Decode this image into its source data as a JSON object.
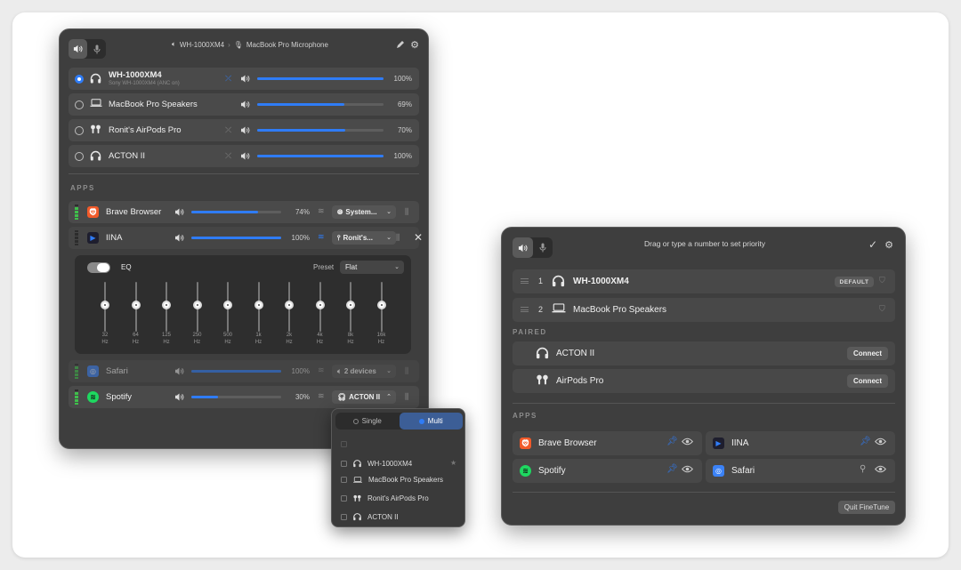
{
  "left": {
    "header_output": "WH-1000XM4",
    "header_sep": "›",
    "header_input": "MacBook Pro Microphone",
    "devices": [
      {
        "name": "WH-1000XM4",
        "sub": "Sony WH-1000XM4 (ANC on)",
        "percent": "100%",
        "level": 1.0,
        "icon": "headphones-icon",
        "selected": true
      },
      {
        "name": "MacBook Pro Speakers",
        "sub": "",
        "percent": "69%",
        "level": 0.69,
        "icon": "laptop-icon",
        "selected": false
      },
      {
        "name": "Ronit's AirPods Pro",
        "sub": "",
        "percent": "70%",
        "level": 0.7,
        "icon": "airpods-icon",
        "selected": false
      },
      {
        "name": "ACTON II",
        "sub": "",
        "percent": "100%",
        "level": 1.0,
        "icon": "headphones-icon",
        "selected": false
      }
    ],
    "apps_title": "APPS",
    "apps": [
      {
        "name": "Brave Browser",
        "percent": "74%",
        "level": 0.74,
        "route": "System...",
        "icon_color": "#f25a2a",
        "dim": false
      },
      {
        "name": "IINA",
        "percent": "100%",
        "level": 1.0,
        "route": "Ronit's...",
        "icon_color": "#1e1e2e",
        "dim": false
      },
      {
        "name": "Safari",
        "percent": "100%",
        "level": 1.0,
        "route": "2 devices",
        "icon_color": "#3b82f6",
        "dim": true
      },
      {
        "name": "Spotify",
        "percent": "30%",
        "level": 0.3,
        "route": "ACTON II",
        "icon_color": "#1ed760",
        "dim": false
      }
    ],
    "eq": {
      "label": "EQ",
      "preset_label": "Preset",
      "preset_value": "Flat",
      "bands": [
        {
          "freq": "32",
          "unit": "Hz"
        },
        {
          "freq": "64",
          "unit": "Hz"
        },
        {
          "freq": "125",
          "unit": "Hz"
        },
        {
          "freq": "250",
          "unit": "Hz"
        },
        {
          "freq": "500",
          "unit": "Hz"
        },
        {
          "freq": "1k",
          "unit": "Hz"
        },
        {
          "freq": "2k",
          "unit": "Hz"
        },
        {
          "freq": "4k",
          "unit": "Hz"
        },
        {
          "freq": "8k",
          "unit": "Hz"
        },
        {
          "freq": "16k",
          "unit": "Hz"
        }
      ]
    }
  },
  "popup": {
    "mode_single": "Single",
    "mode_multi": "Multi",
    "items": [
      {
        "name": "WH-1000XM4",
        "icon": "headphones-icon"
      },
      {
        "name": "MacBook Pro Speakers",
        "icon": "laptop-icon"
      },
      {
        "name": "Ronit's AirPods Pro",
        "icon": "airpods-icon"
      },
      {
        "name": "ACTON II",
        "icon": "headphones-icon"
      }
    ]
  },
  "right": {
    "header_hint": "Drag or type a number to set priority",
    "priority": [
      {
        "num": "1",
        "name": "WH-1000XM4",
        "badge": "DEFAULT"
      },
      {
        "num": "2",
        "name": "MacBook Pro Speakers",
        "badge": ""
      }
    ],
    "paired_title": "PAIRED",
    "paired": [
      {
        "name": "ACTON II",
        "action": "Connect"
      },
      {
        "name": "AirPods Pro",
        "action": "Connect"
      }
    ],
    "apps_title": "APPS",
    "apps": [
      {
        "name": "Brave Browser",
        "pinned": true
      },
      {
        "name": "IINA",
        "pinned": true
      },
      {
        "name": "Spotify",
        "pinned": true
      },
      {
        "name": "Safari",
        "pinned": false
      }
    ],
    "quit_label": "Quit FineTune"
  },
  "colors": {
    "accent": "#2f7cf6",
    "panel": "#3e3e3e",
    "row": "#4a4a4a"
  }
}
